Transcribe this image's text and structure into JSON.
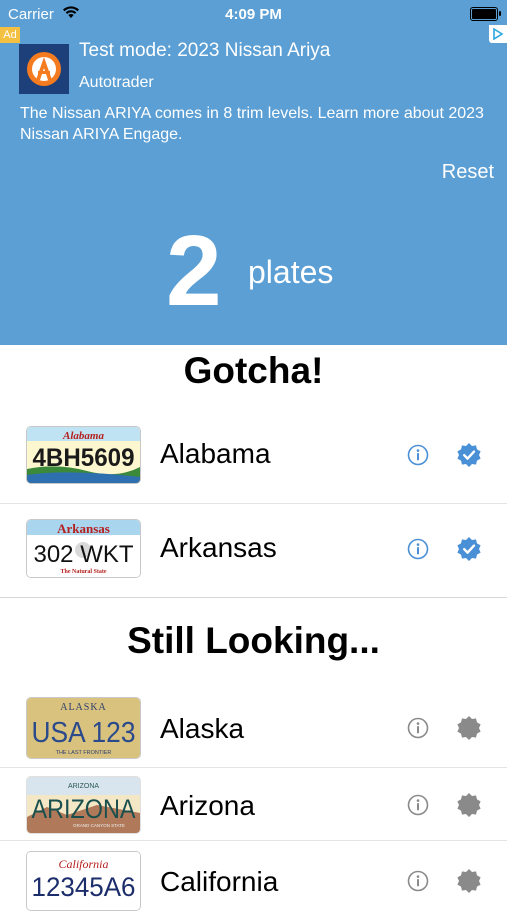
{
  "status_bar": {
    "carrier": "Carrier",
    "time": "4:09 PM"
  },
  "ad": {
    "tag": "Ad",
    "title": "Test mode: 2023 Nissan Ariya",
    "advertiser": "Autotrader",
    "description": "The Nissan ARIYA comes in 8 trim levels. Learn more about 2023 Nissan ARIYA Engage."
  },
  "header": {
    "reset_label": "Reset",
    "count": "2",
    "count_label": "plates"
  },
  "sections": {
    "found_title": "Gotcha!",
    "looking_title": "Still Looking..."
  },
  "found": [
    {
      "name": "Alabama",
      "plate_top": "Alabama",
      "plate_number": "4BH5609"
    },
    {
      "name": "Arkansas",
      "plate_top": "Arkansas",
      "plate_number": "302 WKT",
      "plate_bottom": "The Natural State"
    }
  ],
  "looking": [
    {
      "name": "Alaska",
      "plate_top": "ALASKA",
      "plate_number": "USA 123",
      "plate_bottom": "THE LAST FRONTIER"
    },
    {
      "name": "Arizona",
      "plate_top": "ARIZONA",
      "plate_number": "ARIZONA",
      "plate_bottom": "GRAND CANYON STATE"
    },
    {
      "name": "California",
      "plate_top": "California",
      "plate_number": "12345A6"
    }
  ],
  "colors": {
    "header": "#5b9fd4",
    "found_check": "#4a90d6",
    "looking_check": "#8a8a8a"
  },
  "icons": {
    "info": "info-circle-icon",
    "found": "checkmark-seal-icon",
    "looking": "seal-icon"
  }
}
